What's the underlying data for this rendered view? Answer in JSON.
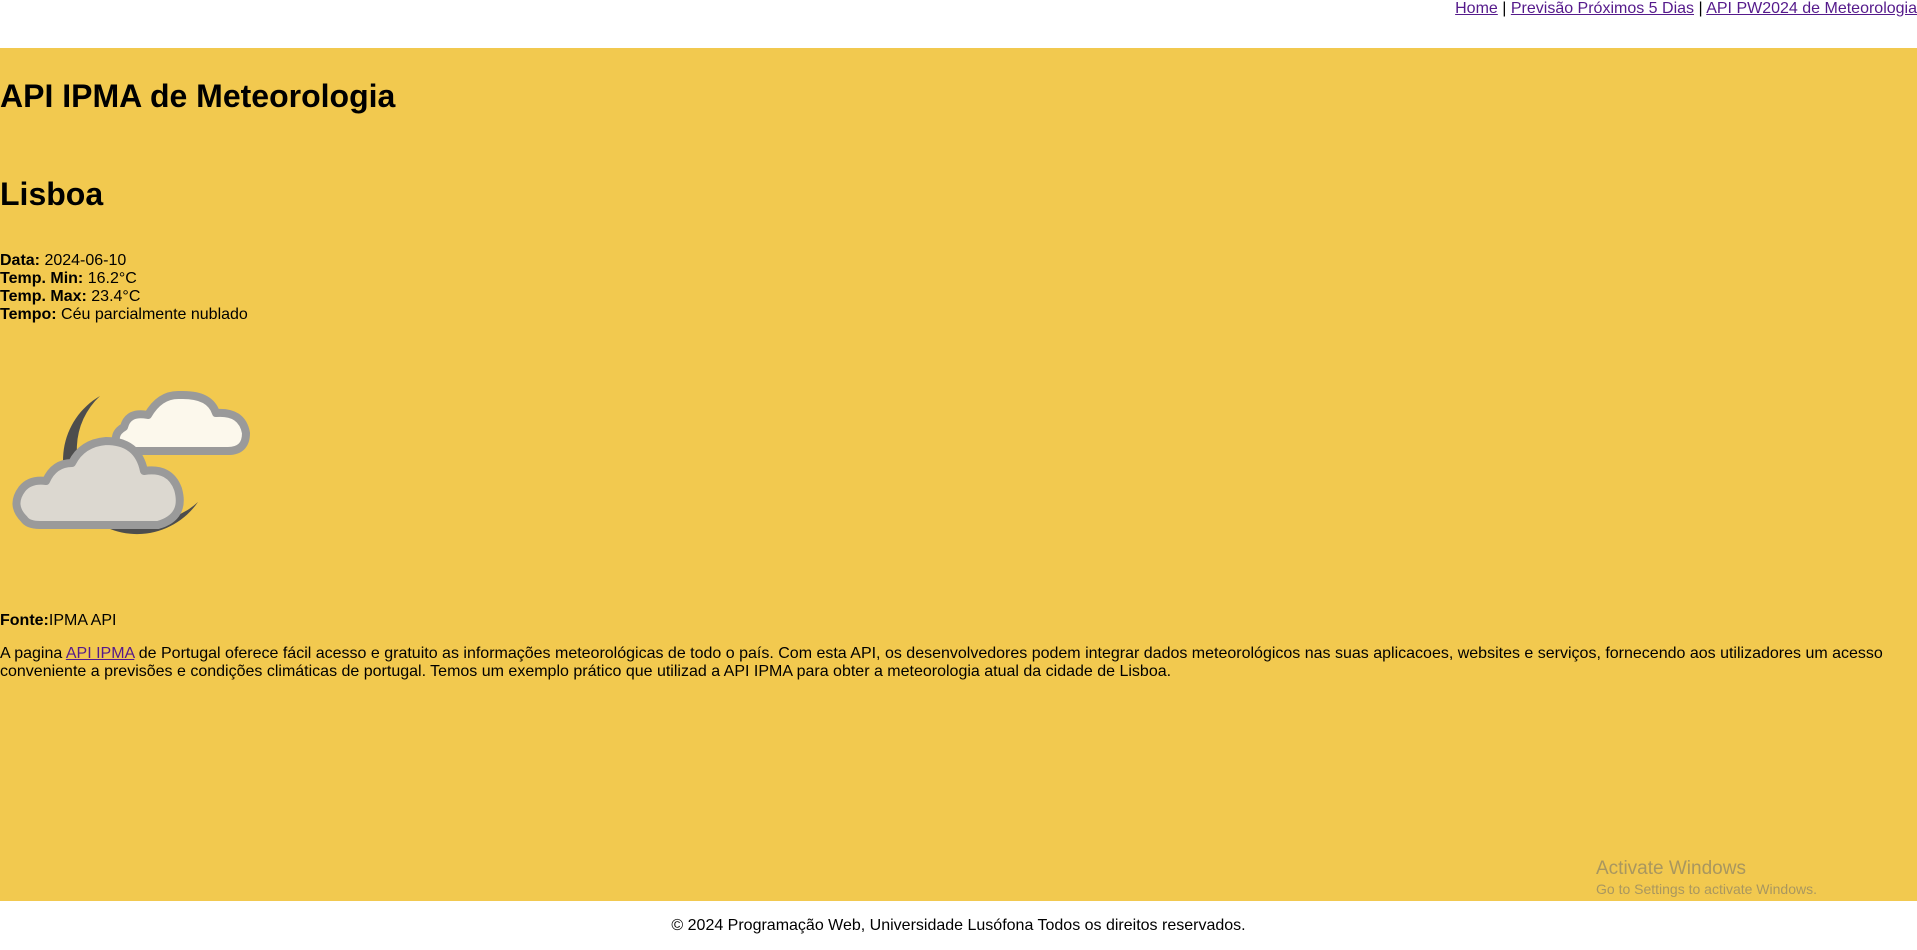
{
  "nav": {
    "home": "Home",
    "sep1": " | ",
    "forecast": "Previsão Próximos 5 Dias",
    "sep2": " | ",
    "api": "API PW2024 de Meteorologia"
  },
  "header": {
    "title": "API IPMA de Meteorologia"
  },
  "weather": {
    "city": "Lisboa",
    "date_label": "Data:",
    "date_value": " 2024-06-10",
    "tmin_label": "Temp. Min:",
    "tmin_value": " 16.2°C",
    "tmax_label": "Temp. Max:",
    "tmax_value": " 23.4°C",
    "desc_label": "Tempo:",
    "desc_value": " Céu parcialmente nublado",
    "icon": "partly-cloudy-night-icon"
  },
  "source": {
    "label": "Fonte:",
    "value": "IPMA API"
  },
  "description": {
    "prefix": "A pagina ",
    "link": "API IPMA",
    "suffix": " de Portugal oferece fácil acesso e gratuito as informações meteorológicas de todo o país. Com esta API, os desenvolvedores podem integrar dados meteorológicos nas suas aplicacoes, websites e serviços, fornecendo aos utilizadores um acesso conveniente a previsões e condições climáticas de portugal. Temos um exemplo prático que utilizad a API IPMA para obter a meteorologia atual da cidade de Lisboa."
  },
  "watermark": {
    "line1": "Activate Windows",
    "line2": "Go to Settings to activate Windows."
  },
  "footer": {
    "text": "© 2024 Programação Web, Universidade Lusófona Todos os direitos reservados."
  },
  "colors": {
    "background": "#f2c94f",
    "link": "#551a8b"
  }
}
